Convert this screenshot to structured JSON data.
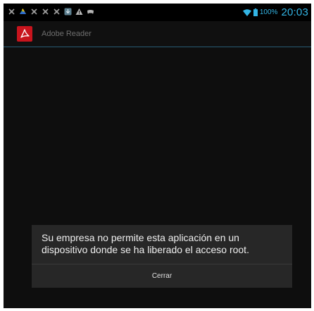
{
  "status_bar": {
    "notification_icons": [
      "usb-debug-icon",
      "drive-icon",
      "usb-debug-icon",
      "usb-debug-icon",
      "usb-debug-icon",
      "download-icon",
      "warning-icon",
      "game-controller-icon"
    ],
    "battery_percent": "100%",
    "time": "20:03",
    "accent_color": "#33b5e5"
  },
  "action_bar": {
    "app_title": "Adobe Reader",
    "app_icon": "adobe-reader-icon",
    "icon_color": "#c8141d"
  },
  "dialog": {
    "message": "Su empresa no permite esta aplicación en un dispositivo donde se ha liberado el acceso root.",
    "button_label": "Cerrar"
  }
}
